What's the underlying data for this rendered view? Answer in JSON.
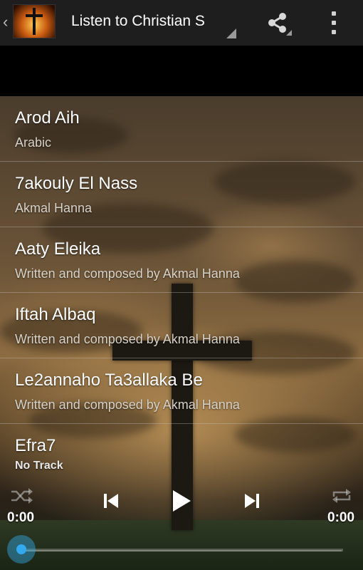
{
  "actionbar": {
    "title": "Listen to Christian S",
    "back_glyph": "‹",
    "icons": [
      "app-logo-cross",
      "share-icon",
      "overflow-menu-icon"
    ]
  },
  "tracks": [
    {
      "title": "Arod Aih",
      "subtitle": "Arabic"
    },
    {
      "title": "7akouly El Nass",
      "subtitle": "Akmal Hanna"
    },
    {
      "title": "Aaty Eleika",
      "subtitle": "Written and composed by Akmal Hanna"
    },
    {
      "title": "Iftah Albaq",
      "subtitle": "Written and composed by Akmal Hanna"
    },
    {
      "title": "Le2annaho Ta3allaka Be",
      "subtitle": "Written and composed by Akmal Hanna"
    },
    {
      "title": "Efra7",
      "subtitle": ""
    }
  ],
  "player": {
    "now_playing": "No Track",
    "elapsed": "0:00",
    "duration": "0:00",
    "progress": 0,
    "accent_color": "#33aaee",
    "icons": [
      "shuffle-icon",
      "previous-icon",
      "play-icon",
      "next-icon",
      "repeat-icon"
    ]
  }
}
